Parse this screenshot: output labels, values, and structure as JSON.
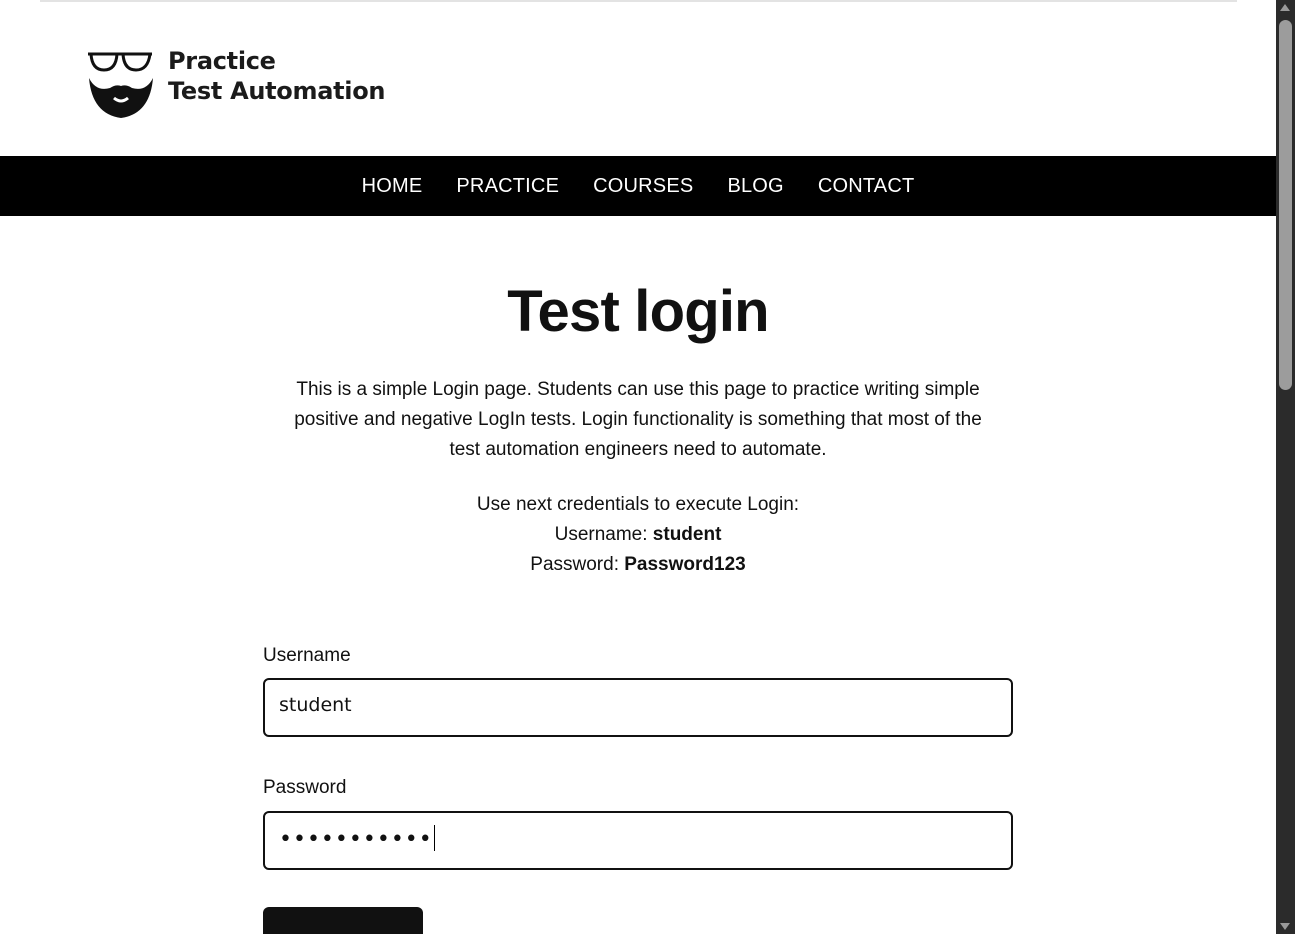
{
  "brand": {
    "line1": "Practice",
    "line2": "Test Automation",
    "logo_icon": "bearded-man-with-glasses-icon"
  },
  "nav": {
    "items": [
      {
        "label": "HOME"
      },
      {
        "label": "PRACTICE"
      },
      {
        "label": "COURSES"
      },
      {
        "label": "BLOG"
      },
      {
        "label": "CONTACT"
      }
    ]
  },
  "main": {
    "title": "Test login",
    "intro": "This is a simple Login page. Students can use this page to practice writing simple positive and negative LogIn tests. Login functionality is something that most of the test automation engineers need to automate.",
    "credentials": {
      "heading": "Use next credentials to execute Login:",
      "username_label": "Username: ",
      "username_value": "student",
      "password_label": "Password: ",
      "password_value": "Password123"
    }
  },
  "form": {
    "username": {
      "label": "Username",
      "value": "student"
    },
    "password": {
      "label": "Password",
      "masked_value": "•••••••••••"
    },
    "submit_label": ""
  },
  "colors": {
    "nav_bg": "#000000",
    "nav_text": "#ffffff",
    "text": "#111111",
    "scrollbar_track": "#2b2b2b",
    "scrollbar_thumb": "#9c9c9c"
  }
}
